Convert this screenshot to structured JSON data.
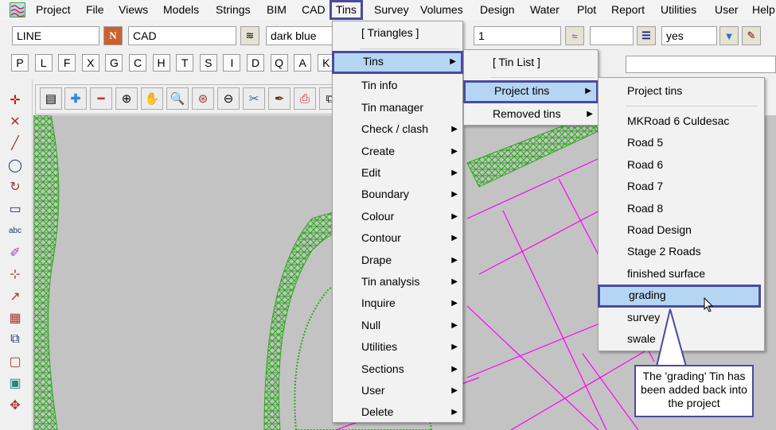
{
  "menubar": {
    "items": [
      "Project",
      "File",
      "Views",
      "Models",
      "Strings",
      "BIM",
      "CAD",
      "Tins",
      "Survey",
      "Volumes",
      "Design",
      "Water",
      "Plot",
      "Report",
      "Utilities",
      "User",
      "Help"
    ]
  },
  "toolbar": {
    "string_type": "LINE",
    "model": "CAD",
    "colour": "dark blue",
    "weight": "1",
    "style": "",
    "flag": "yes",
    "n_label": "N"
  },
  "letters": [
    "P",
    "L",
    "F",
    "X",
    "G",
    "C",
    "H",
    "T",
    "S",
    "I",
    "D",
    "Q",
    "A",
    "K"
  ],
  "tins_menu": {
    "items": [
      {
        "label": "[ Triangles ]",
        "sub": false
      },
      {
        "label": "Tins",
        "sub": true
      },
      {
        "label": "Tin info",
        "sub": false
      },
      {
        "label": "Tin manager",
        "sub": false
      },
      {
        "label": "Check / clash",
        "sub": true
      },
      {
        "label": "Create",
        "sub": true
      },
      {
        "label": "Edit",
        "sub": true
      },
      {
        "label": "Boundary",
        "sub": true
      },
      {
        "label": "Colour",
        "sub": true
      },
      {
        "label": "Contour",
        "sub": true
      },
      {
        "label": "Drape",
        "sub": true
      },
      {
        "label": "Tin analysis",
        "sub": true
      },
      {
        "label": "Inquire",
        "sub": true
      },
      {
        "label": "Null",
        "sub": true
      },
      {
        "label": "Utilities",
        "sub": true
      },
      {
        "label": "Sections",
        "sub": true
      },
      {
        "label": "User",
        "sub": true
      },
      {
        "label": "Delete",
        "sub": true
      }
    ]
  },
  "tins_submenu": {
    "items": [
      "[ Tin List ]",
      "Project tins",
      "Removed tins"
    ]
  },
  "project_tins": {
    "header": "Project tins",
    "items": [
      "MKRoad 6 Culdesac",
      "Road 5",
      "Road 6",
      "Road 7",
      "Road 8",
      "Road Design",
      "Stage 2 Roads",
      "finished surface",
      "grading",
      "survey",
      "swale"
    ],
    "selected": "grading"
  },
  "callout": {
    "text": "The 'grading' Tin has been added back into the project"
  },
  "colors": {
    "highlight": "#b5d6f3",
    "accent_border": "#4a4aa0",
    "tin_green": "#2ea81e",
    "string_magenta": "#ff00ff",
    "canvas": "#c3c3c3"
  }
}
